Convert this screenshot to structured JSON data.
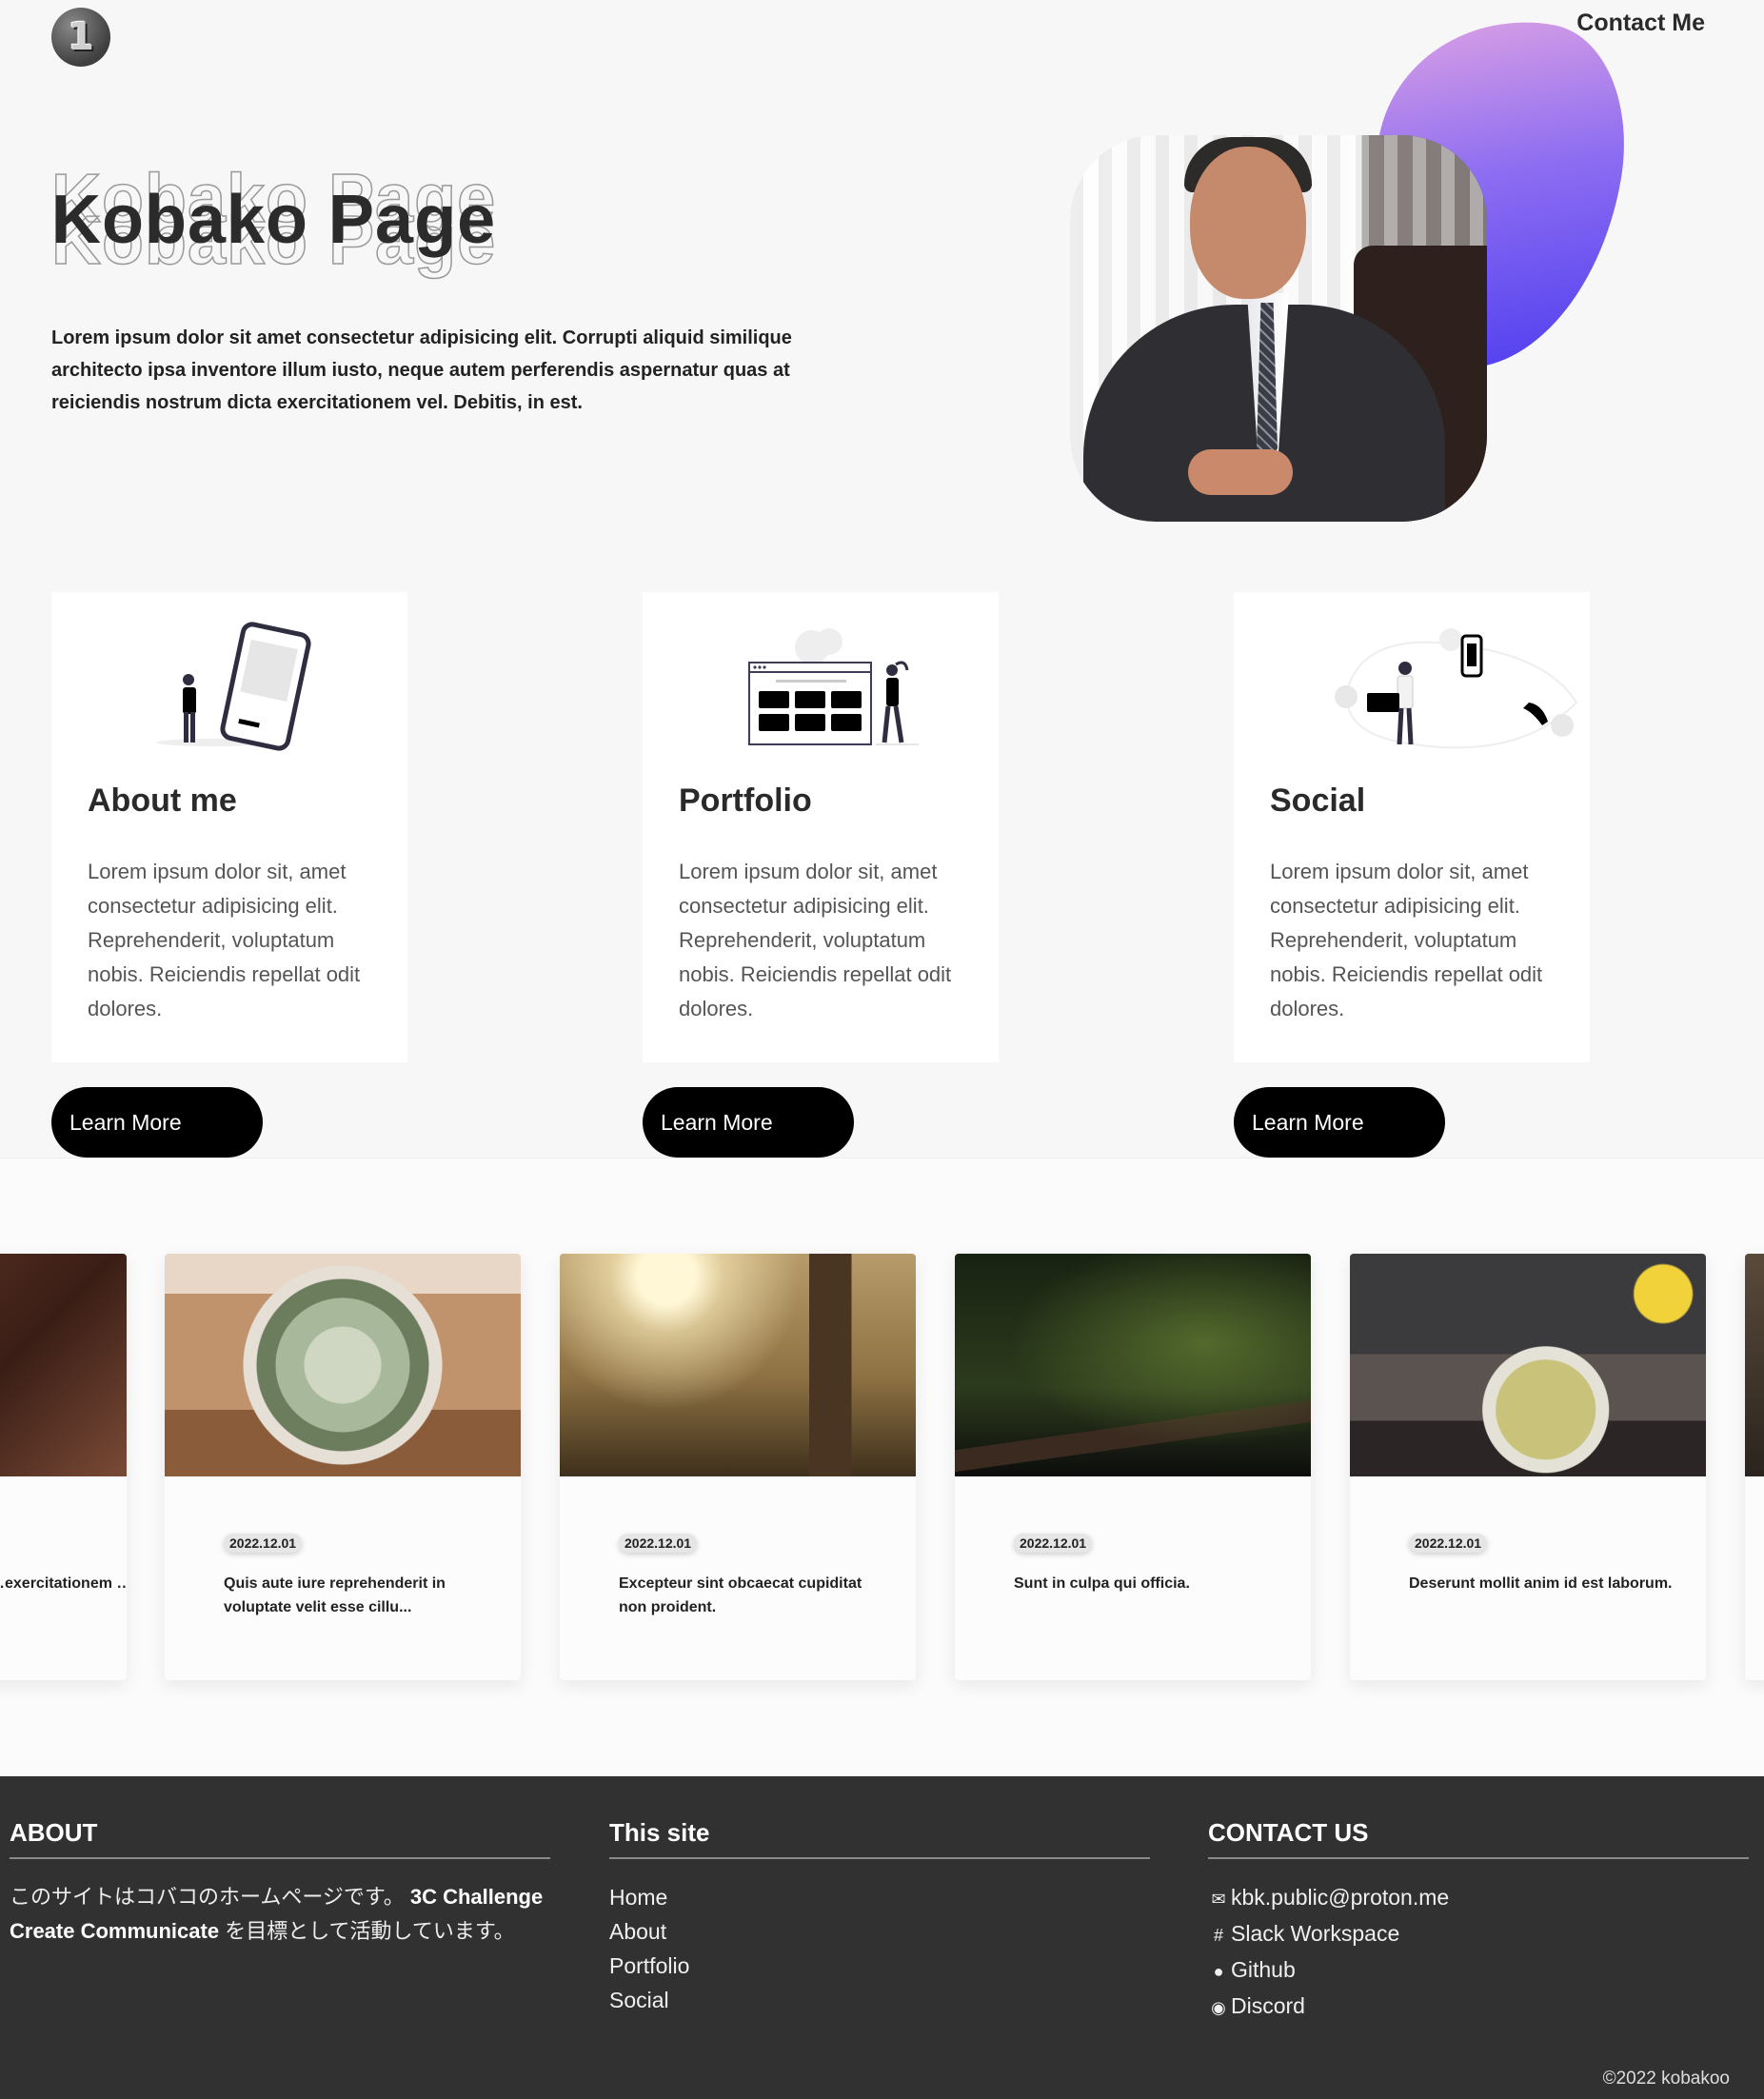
{
  "header": {
    "logo_glyph": "1",
    "contact_label": "Contact Me"
  },
  "hero": {
    "title": "Kobako Page",
    "description": "Lorem ipsum dolor sit amet consectetur adipisicing elit. Corrupti aliquid similique architecto ipsa inventore illum iusto, neque autem perferendis aspernatur quas at reiciendis nostrum dicta exercitationem vel. Debitis, in est.",
    "blob_gradient": [
      "#e4a7e3",
      "#8d6df1",
      "#4a3af0"
    ]
  },
  "cards": [
    {
      "title": "About me",
      "text": "Lorem ipsum dolor sit, amet consectetur adipisicing elit. Reprehenderit, voluptatum nobis. Reiciendis repellat odit dolores.",
      "button": "Learn More",
      "icon": "person-with-phone-illustration"
    },
    {
      "title": "Portfolio",
      "text": "Lorem ipsum dolor sit, amet consectetur adipisicing elit. Reprehenderit, voluptatum nobis. Reiciendis repellat odit dolores.",
      "button": "Learn More",
      "icon": "person-with-browser-illustration"
    },
    {
      "title": "Social",
      "text": "Lorem ipsum dolor sit, amet consectetur adipisicing elit. Reprehenderit, voluptatum nobis. Reiciendis repellat odit dolores.",
      "button": "Learn More",
      "icon": "person-with-devices-illustration"
    }
  ],
  "posts": [
    {
      "date": "",
      "title": "…exercitationem …it…",
      "image": "brick-street-photo"
    },
    {
      "date": "2022.12.01",
      "title": "Quis aute iure reprehenderit in voluptate velit esse cillu...",
      "image": "cactus-photo"
    },
    {
      "date": "2022.12.01",
      "title": "Excepteur sint obcaecat cupiditat non proident.",
      "image": "sunlit-field-photo"
    },
    {
      "date": "2022.12.01",
      "title": "Sunt in culpa qui officia.",
      "image": "night-sky-photo"
    },
    {
      "date": "2022.12.01",
      "title": "Deserunt mollit anim id est laborum.",
      "image": "tea-pot-photo"
    }
  ],
  "footer": {
    "about": {
      "heading": "ABOUT",
      "text_pre": "このサイトはコバコのホームページです。",
      "text_bold1": "3C Challenge Create Communicate",
      "text_post": " を目標として活動しています。"
    },
    "site": {
      "heading": "This site",
      "links": [
        "Home",
        "About",
        "Portfolio",
        "Social"
      ]
    },
    "contact": {
      "heading": "CONTACT US",
      "items": [
        {
          "icon": "mail-icon",
          "label": "kbk.public@proton.me"
        },
        {
          "icon": "slack-icon",
          "label": "Slack Workspace"
        },
        {
          "icon": "github-icon",
          "label": "Github"
        },
        {
          "icon": "discord-icon",
          "label": "Discord"
        }
      ]
    },
    "copyright": "©2022 kobakoo"
  }
}
